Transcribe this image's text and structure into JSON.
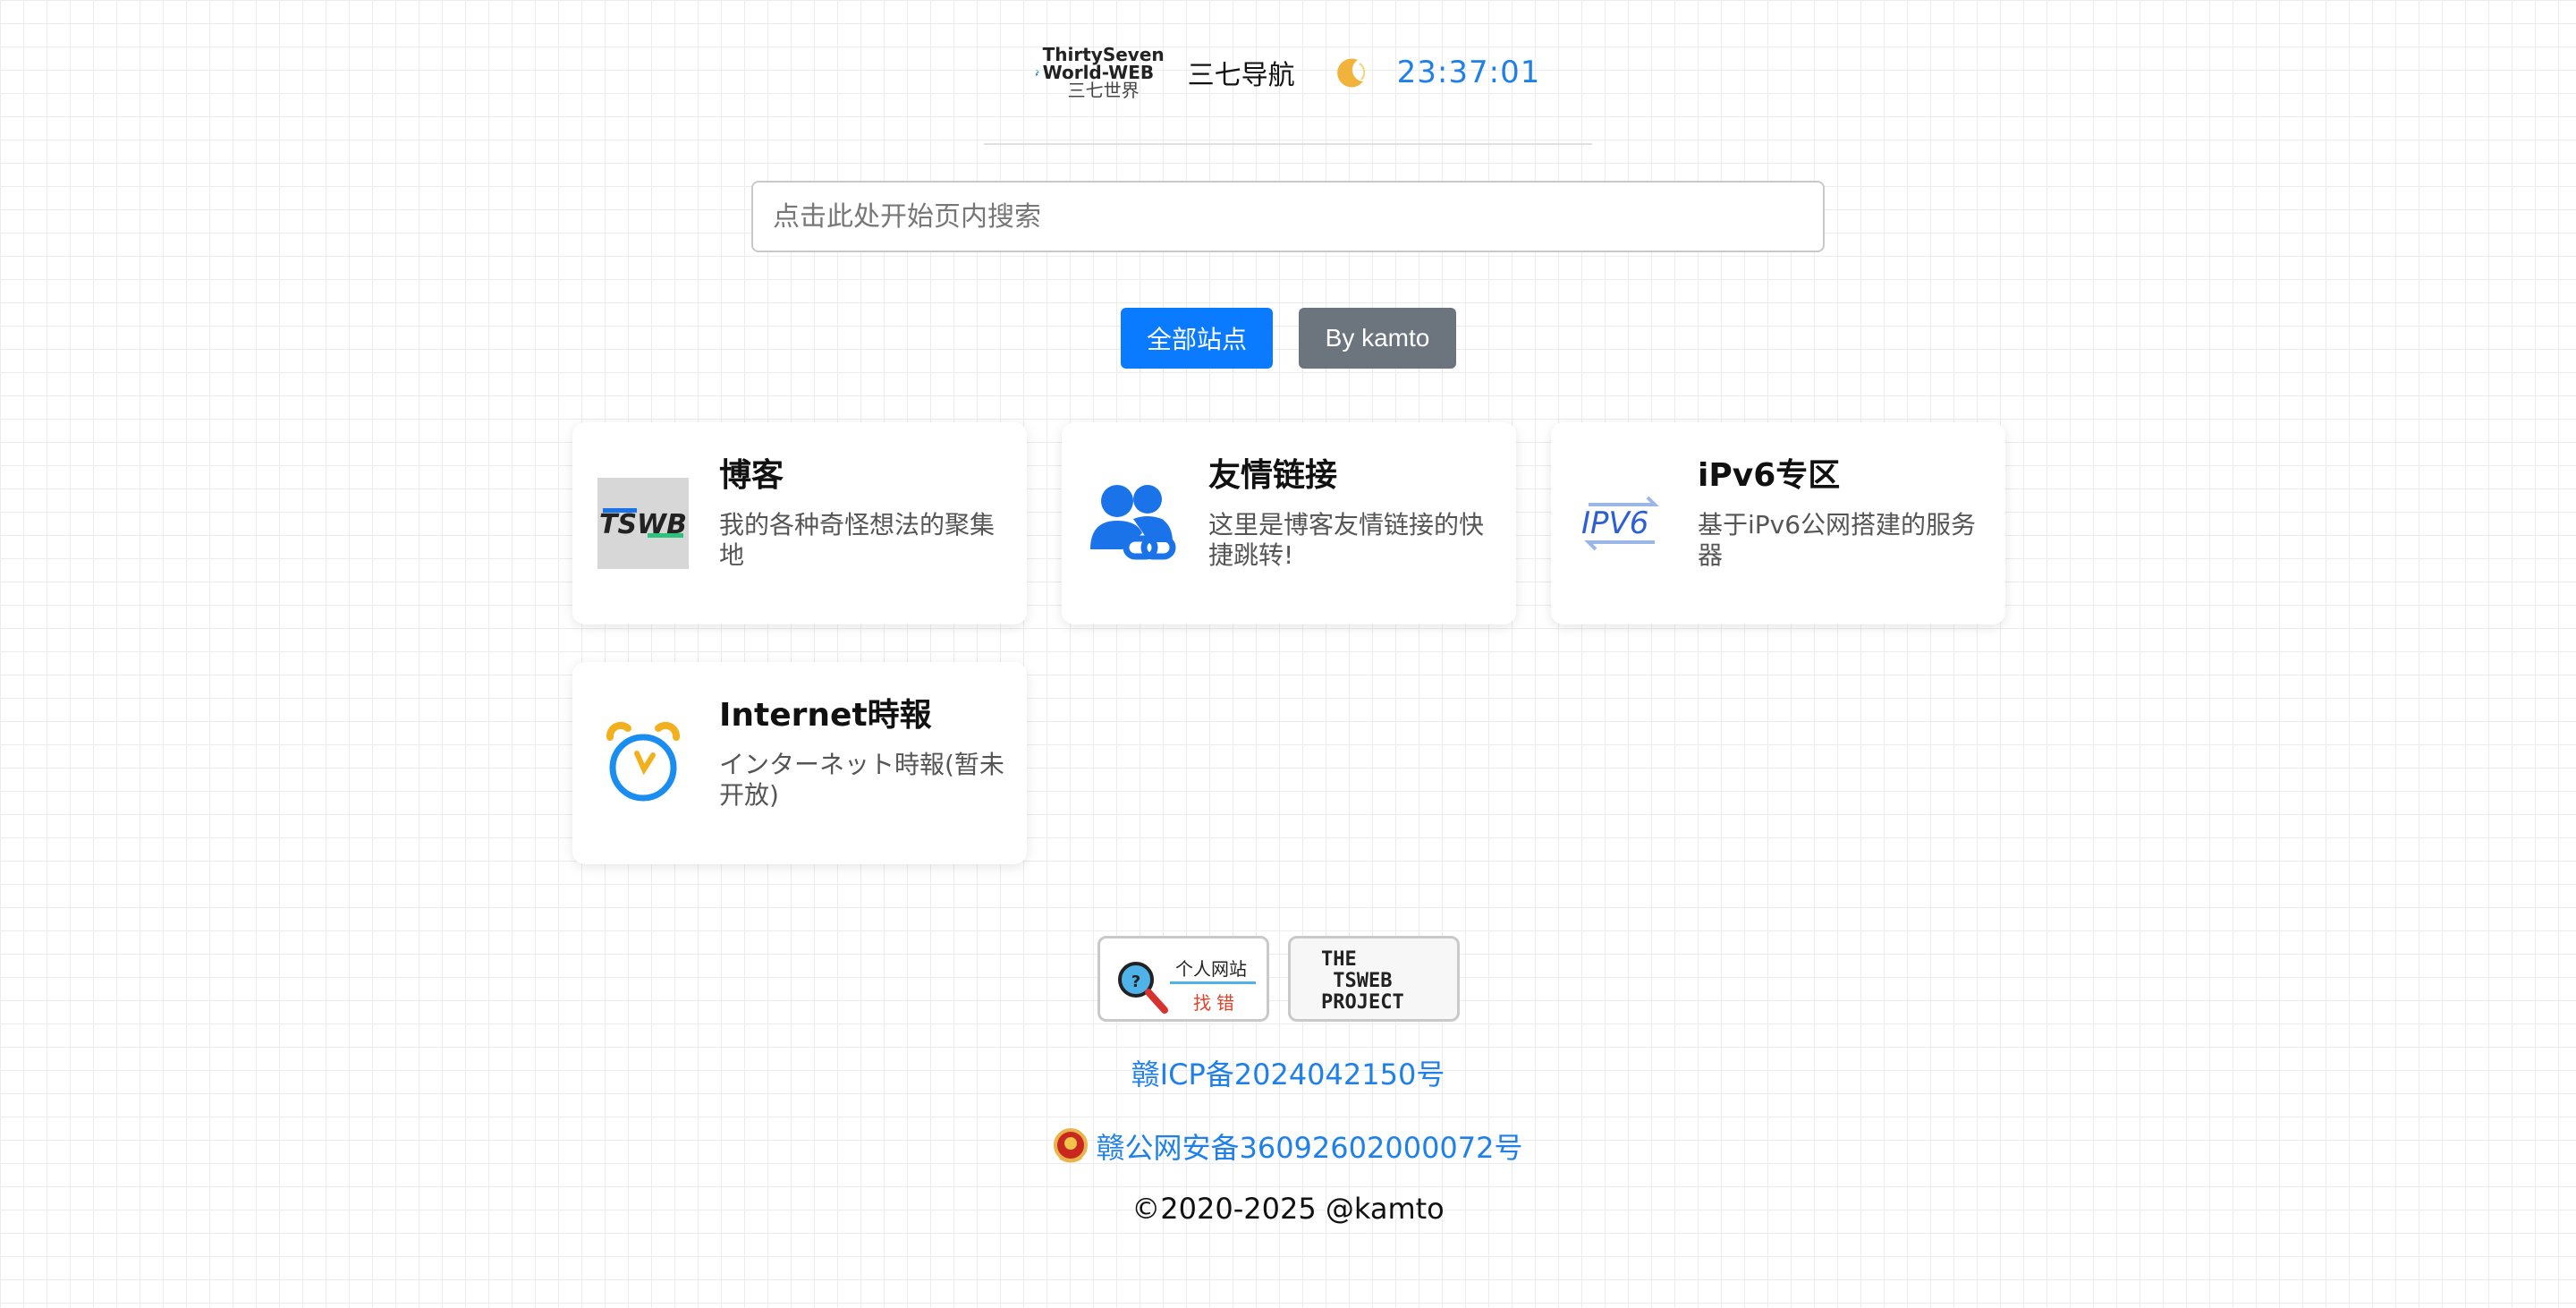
{
  "header": {
    "logo_line1": "ThirtySeven",
    "logo_line2": "World-WEB",
    "logo_line3": "三七世界",
    "site_title": "三七导航",
    "theme_toggle_icon": "moon-icon",
    "clock": "23:37:01"
  },
  "search": {
    "placeholder": "点击此处开始页内搜索"
  },
  "filters": {
    "all_label": "全部站点",
    "by_label": "By kamto"
  },
  "cards": [
    {
      "title": "博客",
      "desc": "我的各种奇怪想法的聚集地",
      "icon": "tswb-logo-icon",
      "icon_text": "TSWB"
    },
    {
      "title": "友情链接",
      "desc": "这里是博客友情链接的快捷跳转!",
      "icon": "users-link-icon"
    },
    {
      "title": "iPv6专区",
      "desc": "基于iPv6公网搭建的服务器",
      "icon": "ipv6-icon",
      "icon_text": "IPV6"
    },
    {
      "title": "Internet時報",
      "desc": "インターネット時報(暂未开放)",
      "icon": "alarm-clock-icon"
    }
  ],
  "footer": {
    "badge1_top": "个人网站",
    "badge1_bottom": "找错",
    "badge2_text": "THE\n TSWEB\nPROJECT",
    "icp": "赣ICP备2024042150号",
    "police": "赣公网安备36092602000072号",
    "copyright": "©2020-2025 @kamto"
  },
  "colors": {
    "accent": "#0a7bff",
    "link": "#1e80e8",
    "secondary": "#6c757d"
  }
}
